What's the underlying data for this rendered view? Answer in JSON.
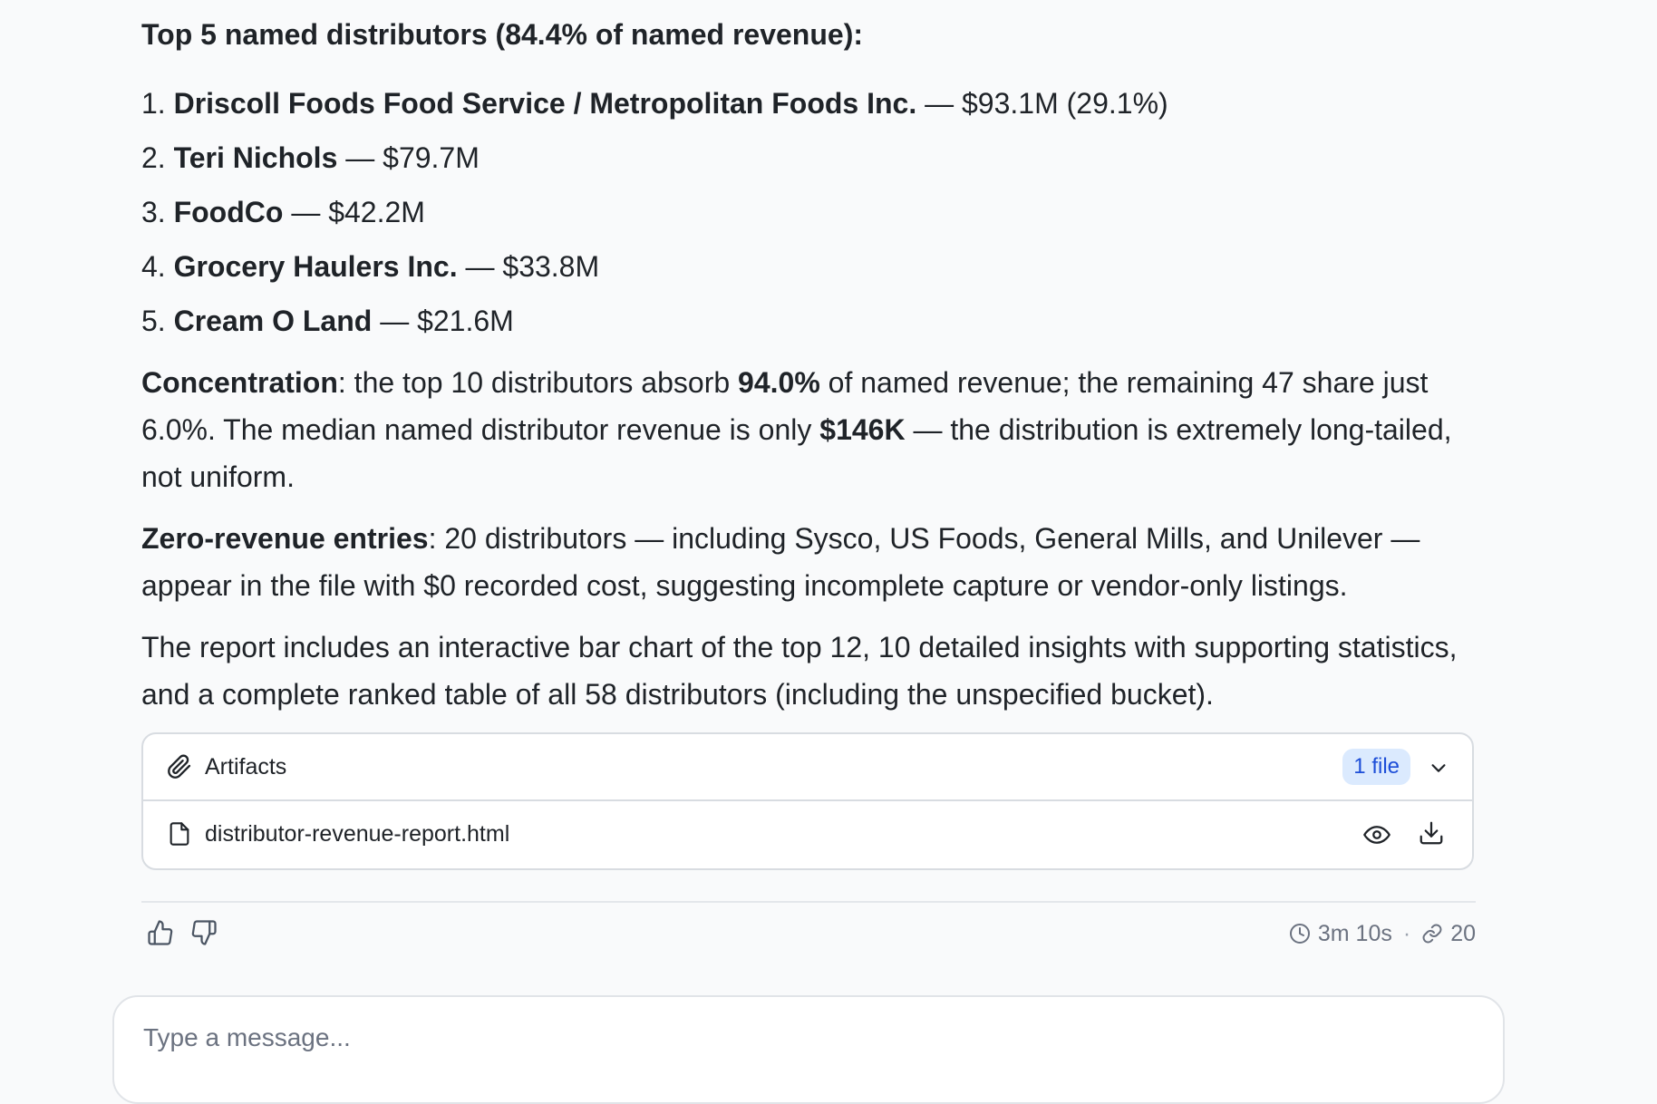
{
  "summary": {
    "heading": "Top 5 named distributors (84.4% of named revenue):",
    "top5": [
      {
        "rank": "1.",
        "name": "Driscoll Foods Food Service / Metropolitan Foods Inc.",
        "detail": " — $93.1M (29.1%)"
      },
      {
        "rank": "2.",
        "name": "Teri Nichols",
        "detail": " — $79.7M"
      },
      {
        "rank": "3.",
        "name": "FoodCo",
        "detail": " — $42.2M"
      },
      {
        "rank": "4.",
        "name": "Grocery Haulers Inc.",
        "detail": " — $33.8M"
      },
      {
        "rank": "5.",
        "name": "Cream O Land",
        "detail": " — $21.6M"
      }
    ],
    "concentration": {
      "label": "Concentration",
      "text_a": ": the top 10 distributors absorb ",
      "pct": "94.0%",
      "text_b": " of named revenue; the remaining 47 share just 6.0%. The median named distributor revenue is only ",
      "median": "$146K",
      "text_c": " — the distribution is extremely long-tailed, not uniform."
    },
    "zero_revenue": {
      "label": "Zero-revenue entries",
      "text": ": 20 distributors — including Sysco, US Foods, General Mills, and Unilever — appear in the file with $0 recorded cost, suggesting incomplete capture or vendor-only listings."
    },
    "report_note": "The report includes an interactive bar chart of the top 12, 10 detailed insights with supporting statistics, and a complete ranked table of all 58 distributors (including the unspecified bucket)."
  },
  "artifacts": {
    "title": "Artifacts",
    "badge": "1 file",
    "files": [
      {
        "name": "distributor-revenue-report.html"
      }
    ]
  },
  "footer": {
    "duration": "3m 10s",
    "separator": "·",
    "sources": "20"
  },
  "composer": {
    "placeholder": "Type a message..."
  },
  "icons": {
    "artifacts": "paperclip-icon",
    "expand": "chevron-down-icon",
    "file": "file-icon",
    "preview": "eye-icon",
    "download": "download-icon",
    "like": "thumbs-up-icon",
    "dislike": "thumbs-down-icon",
    "duration": "clock-icon",
    "sources": "link-icon"
  },
  "colors": {
    "badge_bg": "#dbeafe",
    "badge_text": "#1d4ed8",
    "page_bg": "#f9fafb"
  }
}
